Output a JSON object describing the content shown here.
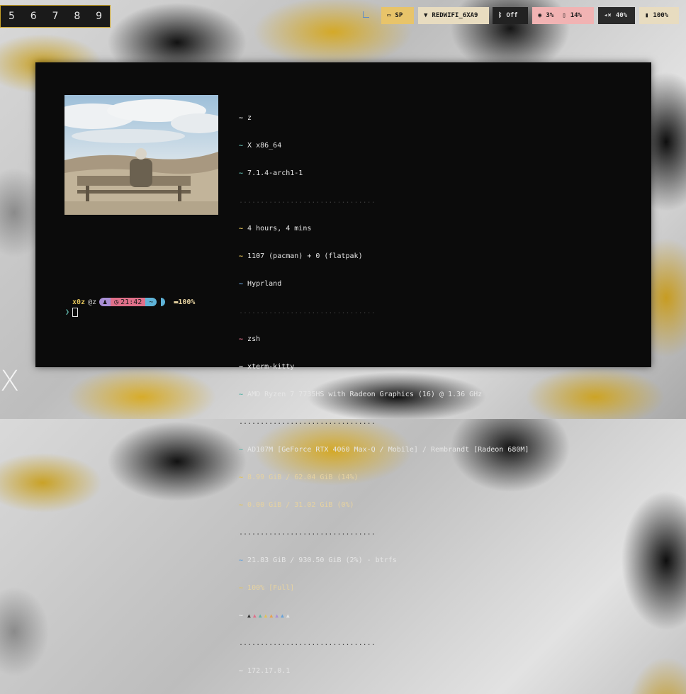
{
  "workspaces": [
    "5",
    "6",
    "7",
    "8",
    "9"
  ],
  "bar": {
    "keyboard": "SP",
    "wifi": "REDWIFI_6XA9",
    "bluetooth": "Off",
    "cpu": "3%",
    "memory": "14%",
    "volume": "40%",
    "battery": "100%"
  },
  "fetch": {
    "user": "z",
    "os": "X x86_64",
    "kernel": "7.1.4-arch1-1",
    "sep1": "................................",
    "uptime": "4 hours, 4 mins",
    "packages": "1107 (pacman) + 0 (flatpak)",
    "wm": "Hyprland",
    "sep2": "................................",
    "shell": "zsh",
    "terminal": "xterm-kitty",
    "cpu": "AMD Ryzen 7 7735HS with Radeon Graphics (16) @ 1.36 GHz",
    "sep3": "................................",
    "gpu": "AD107M [GeForce RTX 4060 Max-Q / Mobile] / Rembrandt [Radeon 680M]",
    "memory": "8.99 GiB / 62.04 GiB (14%)",
    "swap": "0.00 GiB / 31.02 GiB (0%)",
    "sep4": "................................",
    "disk": "21.83 GiB / 930.50 GiB (2%) - btrfs",
    "battery": "100% [Full]",
    "sep5": "................................",
    "ip": "172.17.0.1"
  },
  "prompt": {
    "user": "x0z",
    "host": "@z",
    "time": "21:42",
    "dir": "~",
    "battery": "100%",
    "symbol": "❯"
  },
  "colors": {
    "accent": "#c9a227",
    "terminal_bg": "#0b0b0b",
    "teal": "#5fb3a8",
    "yellow": "#e1c25a",
    "pink": "#e0708a",
    "purple": "#a98fd6",
    "blue": "#6aa3d8"
  }
}
